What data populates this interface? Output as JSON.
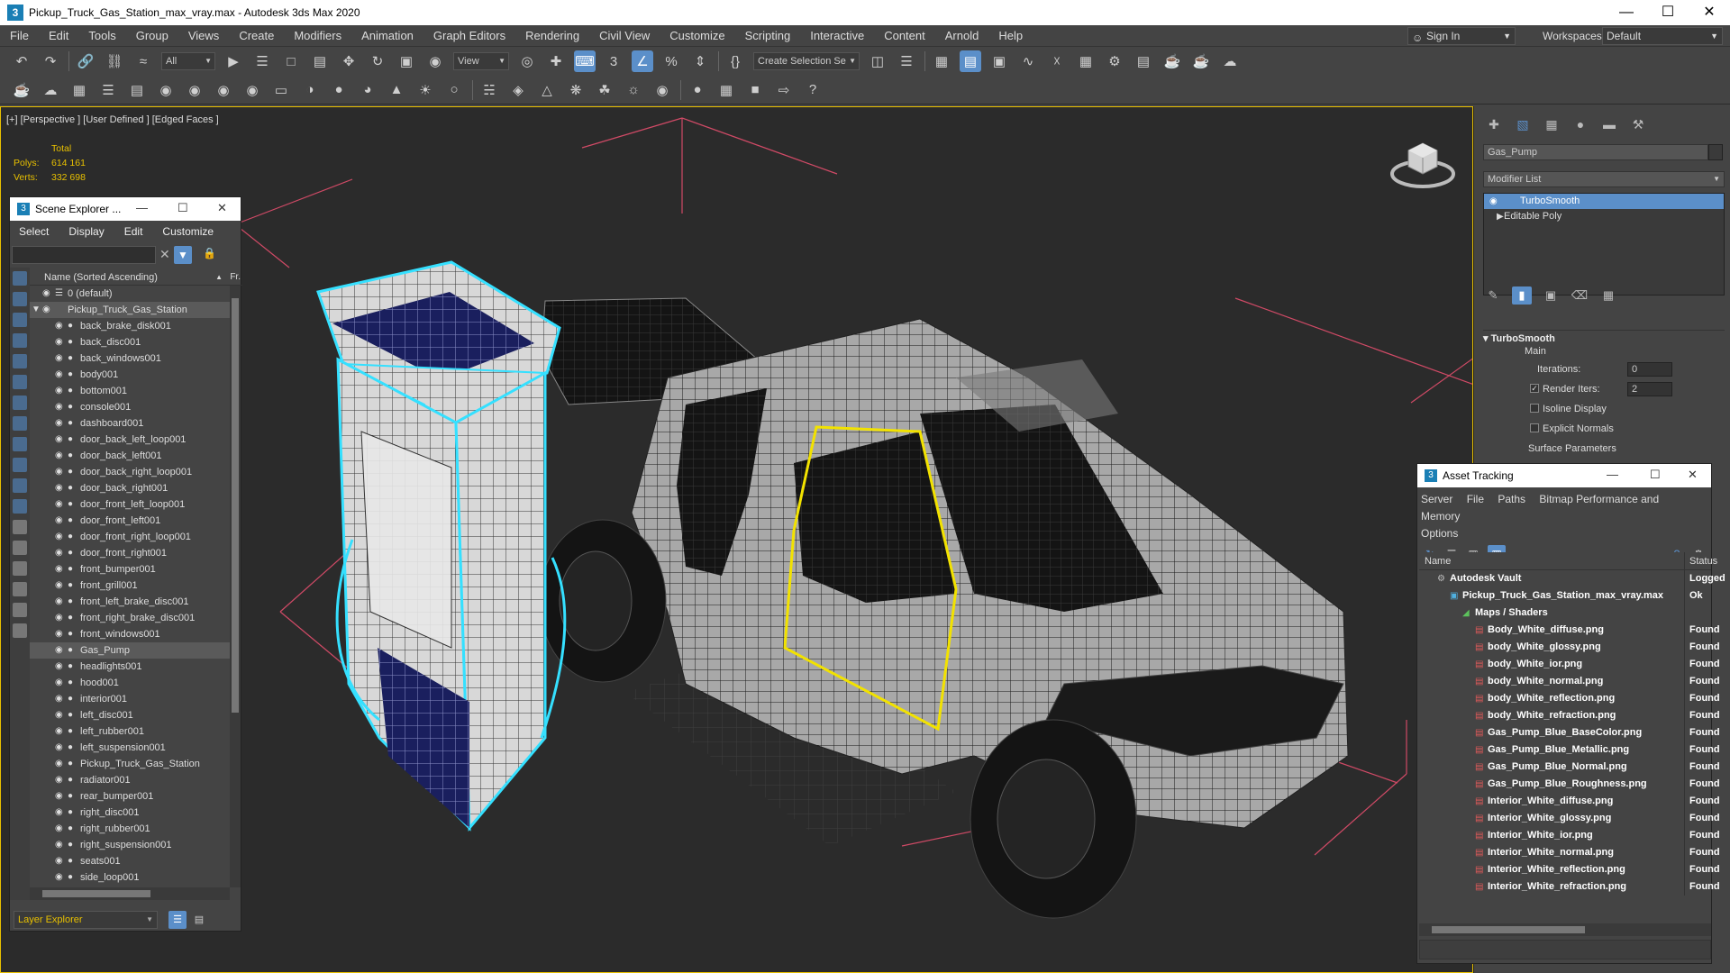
{
  "window": {
    "title": "Pickup_Truck_Gas_Station_max_vray.max - Autodesk 3ds Max 2020"
  },
  "menu": [
    "File",
    "Edit",
    "Tools",
    "Group",
    "Views",
    "Create",
    "Modifiers",
    "Animation",
    "Graph Editors",
    "Rendering",
    "Civil View",
    "Customize",
    "Scripting",
    "Interactive",
    "Content",
    "Arnold",
    "Help"
  ],
  "signin": "Sign In",
  "workspaces": {
    "label": "Workspaces:",
    "value": "Default"
  },
  "toolbar": {
    "filter": "All",
    "view": "View",
    "selection_set": "Create Selection Se",
    "angle_snap_value": "3"
  },
  "viewport": {
    "label": "[+] [Perspective ] [User Defined ] [Edged Faces ]",
    "stats": {
      "total": "Total",
      "polys_label": "Polys:",
      "polys": "614 161",
      "verts_label": "Verts:",
      "verts": "332 698"
    }
  },
  "scene_explorer": {
    "title": "Scene Explorer ...",
    "menu": [
      "Select",
      "Display",
      "Edit",
      "Customize"
    ],
    "column": "Name (Sorted Ascending)",
    "column_right": "Fr.",
    "layer": "0 (default)",
    "group": "Pickup_Truck_Gas_Station",
    "items": [
      "back_brake_disk001",
      "back_disc001",
      "back_windows001",
      "body001",
      "bottom001",
      "console001",
      "dashboard001",
      "door_back_left_loop001",
      "door_back_left001",
      "door_back_right_loop001",
      "door_back_right001",
      "door_front_left_loop001",
      "door_front_left001",
      "door_front_right_loop001",
      "door_front_right001",
      "front_bumper001",
      "front_grill001",
      "front_left_brake_disc001",
      "front_right_brake_disc001",
      "front_windows001",
      "Gas_Pump",
      "headlights001",
      "hood001",
      "interior001",
      "left_disc001",
      "left_rubber001",
      "left_suspension001",
      "Pickup_Truck_Gas_Station",
      "radiator001",
      "rear_bumper001",
      "right_disc001",
      "right_rubber001",
      "right_suspension001",
      "seats001",
      "side_loop001"
    ],
    "selected": "Gas_Pump",
    "footer": "Layer Explorer"
  },
  "command_panel": {
    "object_name": "Gas_Pump",
    "modifier_list": "Modifier List",
    "stack": [
      "TurboSmooth",
      "Editable Poly"
    ],
    "rollout": {
      "title": "TurboSmooth",
      "section": "Main",
      "iterations_label": "Iterations:",
      "iterations": "0",
      "render_iters_label": "Render Iters:",
      "render_iters": "2",
      "isoline": "Isoline Display",
      "explicit": "Explicit Normals",
      "surface": "Surface Parameters"
    }
  },
  "asset_tracking": {
    "title": "Asset Tracking",
    "menu": [
      "Server",
      "File",
      "Paths",
      "Bitmap Performance and Memory",
      "Options"
    ],
    "col_name": "Name",
    "col_status": "Status",
    "rows": [
      {
        "name": "Autodesk Vault",
        "status": "Logged",
        "level": 0,
        "icon": "vault-icon"
      },
      {
        "name": "Pickup_Truck_Gas_Station_max_vray.max",
        "status": "Ok",
        "level": 1,
        "icon": "max-file-icon"
      },
      {
        "name": "Maps / Shaders",
        "status": "",
        "level": 2,
        "icon": "maps-icon"
      },
      {
        "name": "Body_White_diffuse.png",
        "status": "Found",
        "level": 3,
        "icon": "png-icon"
      },
      {
        "name": "body_White_glossy.png",
        "status": "Found",
        "level": 3,
        "icon": "png-icon"
      },
      {
        "name": "body_White_ior.png",
        "status": "Found",
        "level": 3,
        "icon": "png-icon"
      },
      {
        "name": "body_White_normal.png",
        "status": "Found",
        "level": 3,
        "icon": "png-icon"
      },
      {
        "name": "body_White_reflection.png",
        "status": "Found",
        "level": 3,
        "icon": "png-icon"
      },
      {
        "name": "body_White_refraction.png",
        "status": "Found",
        "level": 3,
        "icon": "png-icon"
      },
      {
        "name": "Gas_Pump_Blue_BaseColor.png",
        "status": "Found",
        "level": 3,
        "icon": "png-icon"
      },
      {
        "name": "Gas_Pump_Blue_Metallic.png",
        "status": "Found",
        "level": 3,
        "icon": "png-icon"
      },
      {
        "name": "Gas_Pump_Blue_Normal.png",
        "status": "Found",
        "level": 3,
        "icon": "png-icon"
      },
      {
        "name": "Gas_Pump_Blue_Roughness.png",
        "status": "Found",
        "level": 3,
        "icon": "png-icon"
      },
      {
        "name": "Interior_White_diffuse.png",
        "status": "Found",
        "level": 3,
        "icon": "png-icon"
      },
      {
        "name": "Interior_White_glossy.png",
        "status": "Found",
        "level": 3,
        "icon": "png-icon"
      },
      {
        "name": "Interior_White_ior.png",
        "status": "Found",
        "level": 3,
        "icon": "png-icon"
      },
      {
        "name": "Interior_White_normal.png",
        "status": "Found",
        "level": 3,
        "icon": "png-icon"
      },
      {
        "name": "Interior_White_reflection.png",
        "status": "Found",
        "level": 3,
        "icon": "png-icon"
      },
      {
        "name": "Interior_White_refraction.png",
        "status": "Found",
        "level": 3,
        "icon": "png-icon"
      }
    ]
  },
  "colors": {
    "accent": "#5b8fc9",
    "viewport_border": "#e8c000",
    "selection_outline": "#35e0ff",
    "door_highlight": "#f2e200",
    "gas_pump_blue": "#1a1f5e"
  }
}
